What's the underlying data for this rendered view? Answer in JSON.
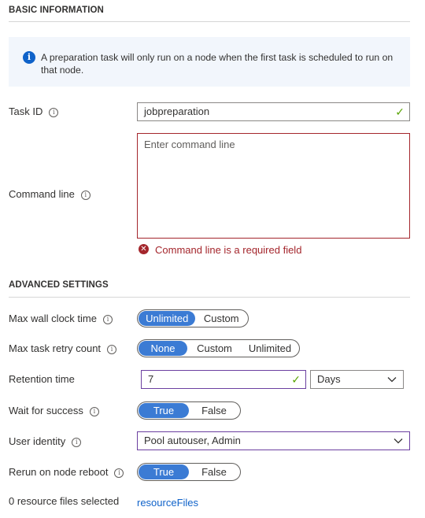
{
  "basic": {
    "title": "BASIC INFORMATION",
    "banner_text": "A preparation task will only run on a node when the first task is scheduled to run on that node.",
    "banner_icon": "info-icon"
  },
  "task_id": {
    "label": "Task ID",
    "value": "jobpreparation",
    "valid": true
  },
  "command_line": {
    "label": "Command line",
    "placeholder": "Enter command line",
    "value": "",
    "error": "Command line is a required field"
  },
  "advanced": {
    "title": "ADVANCED SETTINGS",
    "max_wall_clock": {
      "label": "Max wall clock time",
      "options": [
        "Unlimited",
        "Custom"
      ],
      "selected": "Unlimited"
    },
    "max_retry": {
      "label": "Max task retry count",
      "options": [
        "None",
        "Custom",
        "Unlimited"
      ],
      "selected": "None"
    },
    "retention": {
      "label": "Retention time",
      "value": "7",
      "unit": "Days",
      "valid": true
    },
    "wait_for_success": {
      "label": "Wait for success",
      "options": [
        "True",
        "False"
      ],
      "selected": "True"
    },
    "user_identity": {
      "label": "User identity",
      "value": "Pool autouser, Admin"
    },
    "rerun_on_reboot": {
      "label": "Rerun on node reboot",
      "options": [
        "True",
        "False"
      ],
      "selected": "True"
    },
    "resource_files": {
      "label": "0 resource files selected",
      "link": "resourceFiles"
    }
  },
  "colors": {
    "accent": "#3b7bd4",
    "error": "#a4262c",
    "valid": "#57a300",
    "focus_border": "#6b3fa0",
    "link": "#0f62c9",
    "banner_bg": "#f2f6fc"
  }
}
